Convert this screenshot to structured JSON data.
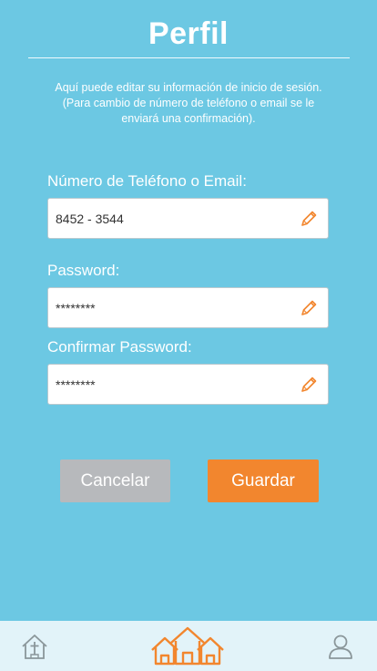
{
  "header": {
    "title": "Perfil"
  },
  "intro_text": "Aquí puede editar su información de inicio de sesión. (Para cambio de número de teléfono o email se le enviará una confirmación).",
  "form": {
    "phone_label": "Número de Teléfono o Email:",
    "phone_value": "8452 - 3544",
    "password_label": "Password:",
    "password_value": "********",
    "confirm_label": "Confirmar Password:",
    "confirm_value": "********"
  },
  "buttons": {
    "cancel": "Cancelar",
    "save": "Guardar"
  },
  "tabbar": {
    "icons": [
      "church-icon",
      "home-icon",
      "user-icon"
    ]
  },
  "colors": {
    "background": "#6cc8e3",
    "accent": "#f2862e",
    "cancel": "#b7b9bc",
    "tabbar": "#e2f3f9"
  }
}
